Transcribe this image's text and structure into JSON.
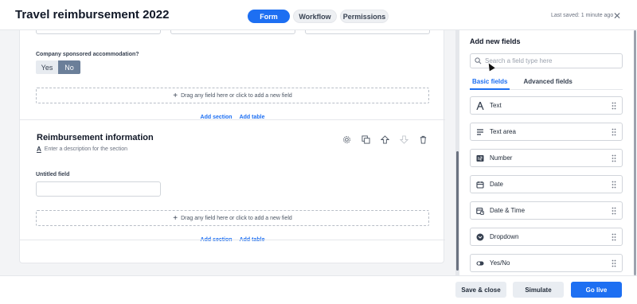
{
  "header": {
    "title": "Travel reimbursement 2022",
    "tabs": [
      {
        "label": "Form",
        "active": true
      },
      {
        "label": "Workflow",
        "active": false
      },
      {
        "label": "Permissions",
        "active": false
      }
    ],
    "last_saved": "Last saved: 1 minute ago",
    "close_icon": "close-icon"
  },
  "form": {
    "accommodation_question": "Company sponsored accommodation?",
    "yes_label": "Yes",
    "no_label": "No",
    "selected": "No",
    "dropzone_text": "Drag any field here or click to add a new field",
    "add_section": "Add section",
    "add_table": "Add table",
    "section": {
      "title": "Reimbursement information",
      "description_placeholder": "Enter a description for the section",
      "tools": [
        "gear-icon",
        "duplicate-icon",
        "arrow-up-icon",
        "arrow-down-icon",
        "trash-icon"
      ]
    },
    "field_label": "Untitled field"
  },
  "panel": {
    "title": "Add new fields",
    "search_placeholder": "Search a field type here",
    "tabs": [
      {
        "label": "Basic fields",
        "active": true
      },
      {
        "label": "Advanced fields",
        "active": false
      }
    ],
    "fields": [
      {
        "label": "Text",
        "icon": "text-icon"
      },
      {
        "label": "Text area",
        "icon": "text-area-icon"
      },
      {
        "label": "Number",
        "icon": "number-icon"
      },
      {
        "label": "Date",
        "icon": "calendar-icon"
      },
      {
        "label": "Date & Time",
        "icon": "calendar-clock-icon"
      },
      {
        "label": "Dropdown",
        "icon": "dropdown-icon"
      },
      {
        "label": "Yes/No",
        "icon": "toggle-icon"
      }
    ]
  },
  "footer": {
    "save_close": "Save & close",
    "simulate": "Simulate",
    "go_live": "Go live"
  },
  "colors": {
    "accent": "#1d6ff2",
    "selected_segment": "#6b7f99"
  }
}
